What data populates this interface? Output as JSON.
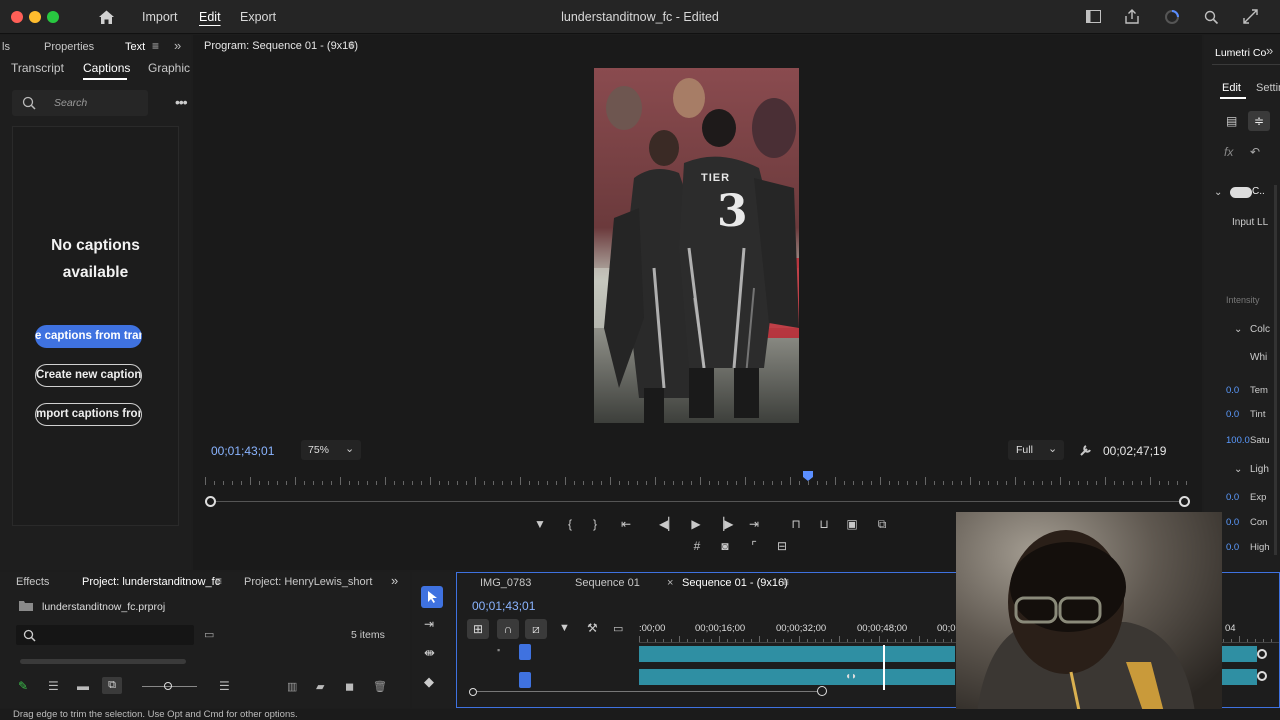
{
  "menubar": {
    "items": [
      "Import",
      "Edit",
      "Export"
    ],
    "active": "Edit",
    "title": "lunderstanditnow_fc - Edited"
  },
  "left_panel": {
    "tabs_top": [
      "ls",
      "Properties",
      "Text"
    ],
    "tabs": [
      "Transcript",
      "Captions",
      "Graphic"
    ],
    "search_placeholder": "Search",
    "empty_title_line1": "No captions",
    "empty_title_line2": "available",
    "btn_transcribe": "e captions from tran",
    "btn_create": "Create new caption",
    "btn_import": "mport captions fron"
  },
  "program_monitor": {
    "title": "Program: Sequence 01 - (9x16)",
    "timecode_current": "00;01;43;01",
    "zoom": "75%",
    "resolution": "Full",
    "timecode_duration": "00;02;47;19",
    "video_caption": "TIER"
  },
  "right_panel": {
    "title": "Lumetri Co",
    "tabs": [
      "Edit",
      "Settin"
    ],
    "input_lut": "Input LL",
    "intensity": "Intensity",
    "section_color": "Colc",
    "white": "Whi",
    "rows": [
      {
        "value": "0.0",
        "label": "Tem"
      },
      {
        "value": "0.0",
        "label": "Tint"
      },
      {
        "value": "100.0",
        "label": "Satu"
      }
    ],
    "section_light": "Ligh",
    "rows2": [
      {
        "value": "0.0",
        "label": "Exp"
      },
      {
        "value": "0.0",
        "label": "Con"
      },
      {
        "value": "0.0",
        "label": "High"
      }
    ]
  },
  "project_panel": {
    "tabs": [
      "Effects",
      "Project: lunderstanditnow_fc",
      "Project: HenryLewis_short"
    ],
    "file": "lunderstanditnow_fc.prproj",
    "items_count": "5 items"
  },
  "timeline": {
    "tabs": [
      "IMG_0783",
      "Sequence 01",
      "Sequence 01 - (9x16)"
    ],
    "timecode": "00;01;43;01",
    "ruler": [
      ":00;00",
      "00;00;16;00",
      "00;00;32;00",
      "00;00;48;00",
      "00;0",
      "04"
    ]
  },
  "status_bar": {
    "text": "Drag edge to trim the selection. Use Opt and Cmd for other options."
  },
  "colors": {
    "accent_blue": "#3f72e0",
    "clip_teal": "#2f8fa3",
    "close": "#ff5f57",
    "minimize": "#febc2e",
    "zoom": "#28c840"
  }
}
